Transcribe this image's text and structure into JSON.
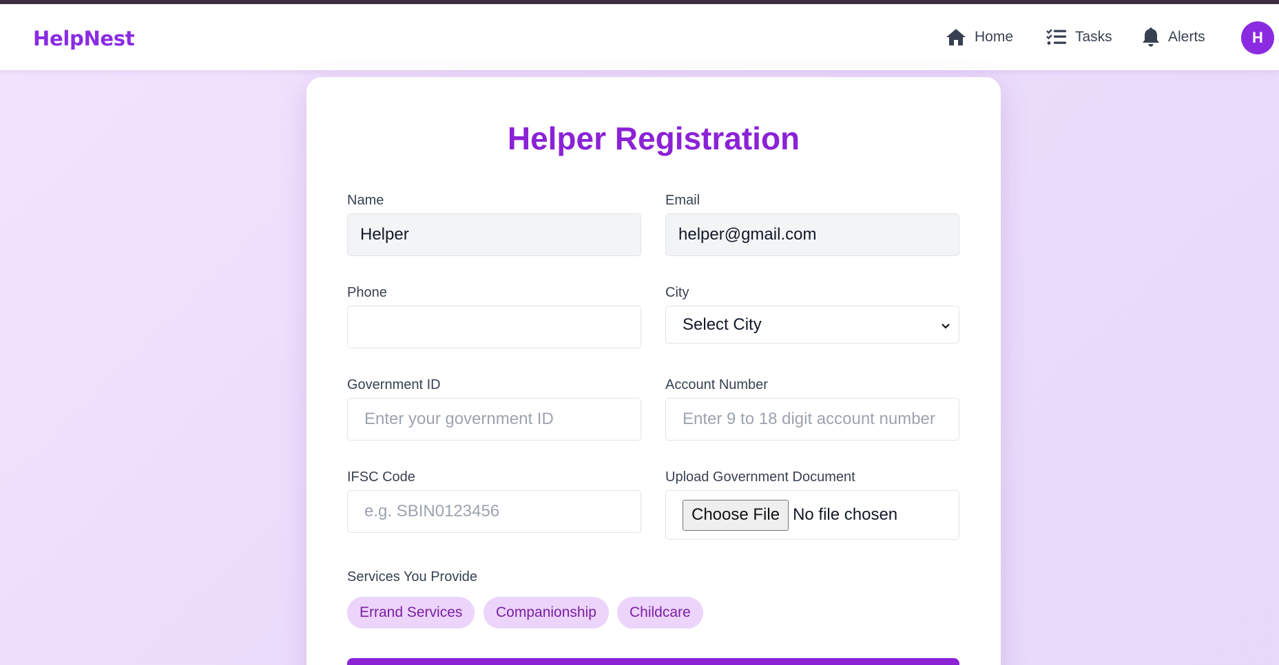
{
  "nav": {
    "brand": "HelpNest",
    "items": [
      {
        "label": "Home",
        "icon": "home-icon"
      },
      {
        "label": "Tasks",
        "icon": "tasks-icon"
      },
      {
        "label": "Alerts",
        "icon": "bell-icon"
      }
    ],
    "avatar_initial": "H"
  },
  "form": {
    "title": "Helper Registration",
    "name": {
      "label": "Name",
      "value": "Helper"
    },
    "email": {
      "label": "Email",
      "value": "helper@gmail.com"
    },
    "phone": {
      "label": "Phone",
      "value": ""
    },
    "city": {
      "label": "City",
      "selected": "Select City"
    },
    "government_id": {
      "label": "Government ID",
      "placeholder": "Enter your government ID"
    },
    "account_number": {
      "label": "Account Number",
      "placeholder": "Enter 9 to 18 digit account number"
    },
    "ifsc": {
      "label": "IFSC Code",
      "placeholder": "e.g. SBIN0123456"
    },
    "upload": {
      "label": "Upload Government Document",
      "button": "Choose File",
      "status": "No file chosen"
    },
    "services": {
      "label": "Services You Provide",
      "chips": [
        "Errand Services",
        "Companionship",
        "Childcare"
      ]
    }
  },
  "colors": {
    "brand": "#8a2be2",
    "title": "#8b22d6",
    "chip_bg": "#ecd4fb",
    "chip_text": "#7b1fa2"
  }
}
